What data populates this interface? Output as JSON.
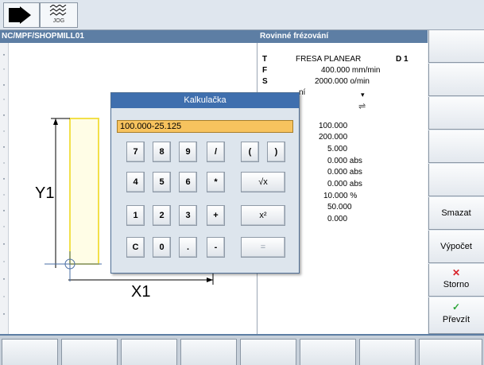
{
  "header": {
    "mode_icon": "single-block-arrow-icon",
    "jog_label": "JOG"
  },
  "path": "NC/MPF/SHOPMILL01",
  "function_title": "Rovinné frézování",
  "params": {
    "tool_letter": "T",
    "tool_name": "FRESA PLANEAR",
    "tool_d": "D 1",
    "feed_letter": "F",
    "feed_value": "400.000 mm/min",
    "speed_letter": "S",
    "speed_value": "2000.000 o/min",
    "partial_label": "ní",
    "values": [
      "100.000",
      "200.000",
      "5.000",
      "0.000 abs",
      "0.000 abs",
      "0.000 abs",
      "10.000 %",
      "50.000",
      "0.000"
    ]
  },
  "graphic": {
    "y_label": "Y1",
    "x_label": "X1"
  },
  "calculator": {
    "title": "Kalkulačka",
    "display": "100.000-25.125",
    "rows": [
      [
        "7",
        "8",
        "9",
        "/",
        "(",
        ")"
      ],
      [
        "4",
        "5",
        "6",
        "*",
        "√x"
      ],
      [
        "1",
        "2",
        "3",
        "+",
        "x²"
      ],
      [
        "C",
        "0",
        ".",
        "-",
        "="
      ]
    ]
  },
  "softkeys_right": [
    "",
    "",
    "",
    "",
    "",
    "Smazat",
    "Výpočet",
    "Storno",
    "Převzít"
  ],
  "colors": {
    "title_bar": "#5d7ea4",
    "dialog_title": "#3f6fae",
    "display_bg": "#f7c35e",
    "cancel_x": "#d8232a",
    "accept_check": "#2fa63a",
    "part_outline": "#f2e04a"
  }
}
